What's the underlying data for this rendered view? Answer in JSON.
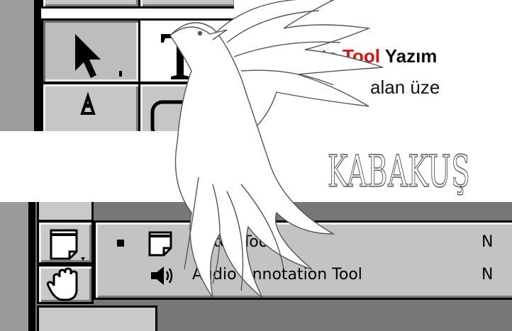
{
  "slide": {
    "title_red": "Note Tool",
    "title_black": "Yazım",
    "subtitle": "alan üze",
    "watermark": "KABAKUŞ"
  },
  "menu": {
    "items": [
      {
        "label": "Notes Tool",
        "shortcut": "N",
        "icon": "note-icon",
        "selected": true
      },
      {
        "label": "Audio Annotation Tool",
        "shortcut": "N",
        "icon": "speaker-icon",
        "selected": false
      }
    ]
  },
  "toolbox": {
    "tools": [
      "select-arrow-icon",
      "text-tool-icon",
      "pen-tool-icon",
      "ellipse-tool-icon",
      "note-tool-icon",
      "hand-tool-icon"
    ]
  },
  "colors": {
    "title_red": "#e01010",
    "toolbox_gray": "#c6c6c6",
    "menu_gray": "#c3c3c3"
  }
}
